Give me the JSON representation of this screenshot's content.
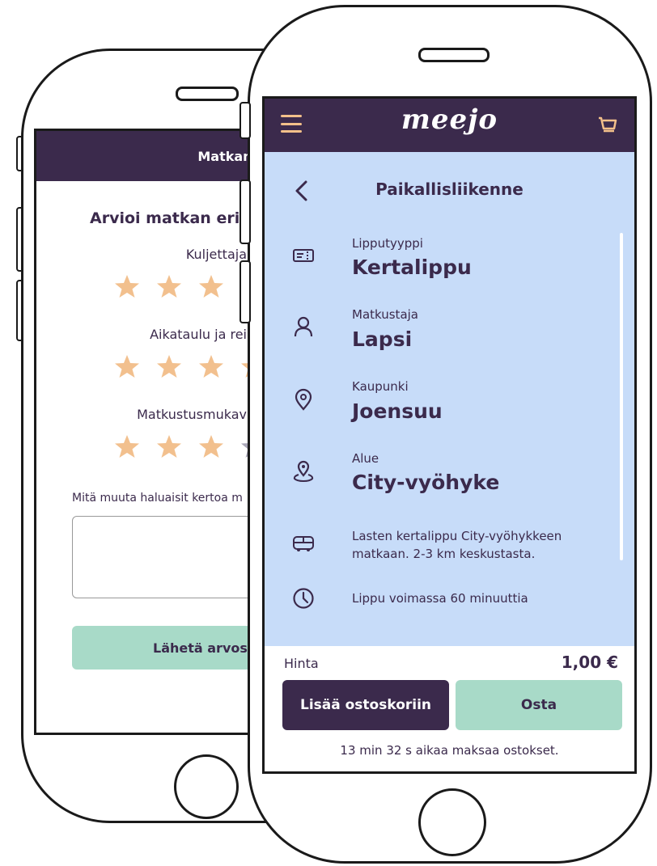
{
  "back": {
    "header_title": "Matkan arvioin",
    "heading": "Arvioi matkan eri o",
    "ratings": [
      {
        "label": "Kuljettaja",
        "stars_filled": 4
      },
      {
        "label": "Aikataulu ja rei",
        "stars_filled": 4
      },
      {
        "label": "Matkustusmukav",
        "stars_filled": 3
      }
    ],
    "question": "Mitä muuta haluaisit kertoa m",
    "send_label": "Lähetä arvoste"
  },
  "front": {
    "logo": "meejo",
    "title": "Paikallisliikenne",
    "ticket_type_label": "Lipputyyppi",
    "ticket_type_value": "Kertalippu",
    "passenger_label": "Matkustaja",
    "passenger_value": "Lapsi",
    "city_label": "Kaupunki",
    "city_value": "Joensuu",
    "zone_label": "Alue",
    "zone_value": "City-vyöhyke",
    "description_line1": "Lasten kertalippu City-vyöhykkeen",
    "description_line2": "matkaan. 2-3 km keskustasta.",
    "validity": "Lippu voimassa 60 minuuttia",
    "price_label": "Hinta",
    "price": "1,00 €",
    "add_to_cart": "Lisää ostoskoriin",
    "buy": "Osta",
    "timer": "13 min 32 s aikaa maksaa ostokset."
  },
  "colors": {
    "brand_dark": "#3b2a4c",
    "accent_peach": "#f3c08a",
    "mint": "#a8dac8",
    "light_blue": "#c7dcf9",
    "star_filled": "#f2c08e",
    "star_empty": "#a9a6b7"
  }
}
